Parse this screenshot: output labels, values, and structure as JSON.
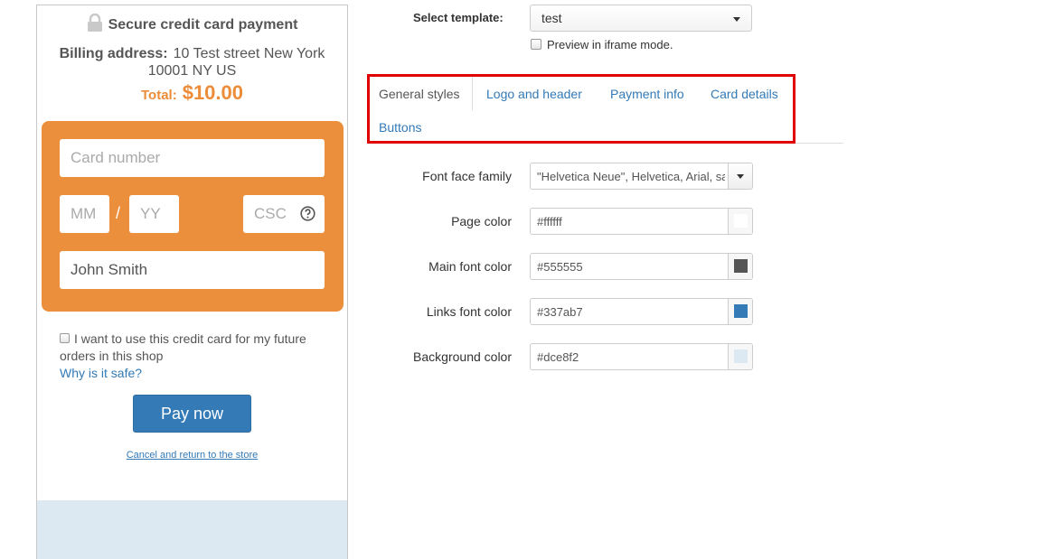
{
  "preview": {
    "title": "Secure credit card payment",
    "billing_label": "Billing address:",
    "billing_value": "10 Test street New York 10001 NY US",
    "total_label": "Total:",
    "total_value": "$10.00",
    "card_number_placeholder": "Card number",
    "mm_placeholder": "MM",
    "slash": "/",
    "yy_placeholder": "YY",
    "csc_placeholder": "CSC",
    "cardholder_name": "John Smith",
    "save_card_text": "I want to use this credit card for my future orders in this shop",
    "why_safe_link": "Why is it safe?",
    "pay_button": "Pay now",
    "cancel_link": "Cancel and return to the store",
    "colors": {
      "card_box": "#ec8f3c",
      "total": "#ec8c38",
      "pay_button": "#337ab7",
      "background": "#dce8f2"
    }
  },
  "editor": {
    "select_template_label": "Select template:",
    "template_value": "test",
    "preview_iframe_label": "Preview in iframe mode.",
    "tabs": [
      {
        "label": "General styles",
        "active": true
      },
      {
        "label": "Logo and header",
        "active": false
      },
      {
        "label": "Payment info",
        "active": false
      },
      {
        "label": "Card details",
        "active": false
      },
      {
        "label": "Buttons",
        "active": false
      }
    ],
    "fields": {
      "font_face_label": "Font face family",
      "font_face_value": "\"Helvetica Neue\", Helvetica, Arial, sans-serif",
      "page_color_label": "Page color",
      "page_color_value": "#ffffff",
      "main_font_color_label": "Main font color",
      "main_font_color_value": "#555555",
      "links_font_color_label": "Links font color",
      "links_font_color_value": "#337ab7",
      "background_color_label": "Background color",
      "background_color_value": "#dce8f2"
    },
    "highlight_color": "#e00000"
  }
}
